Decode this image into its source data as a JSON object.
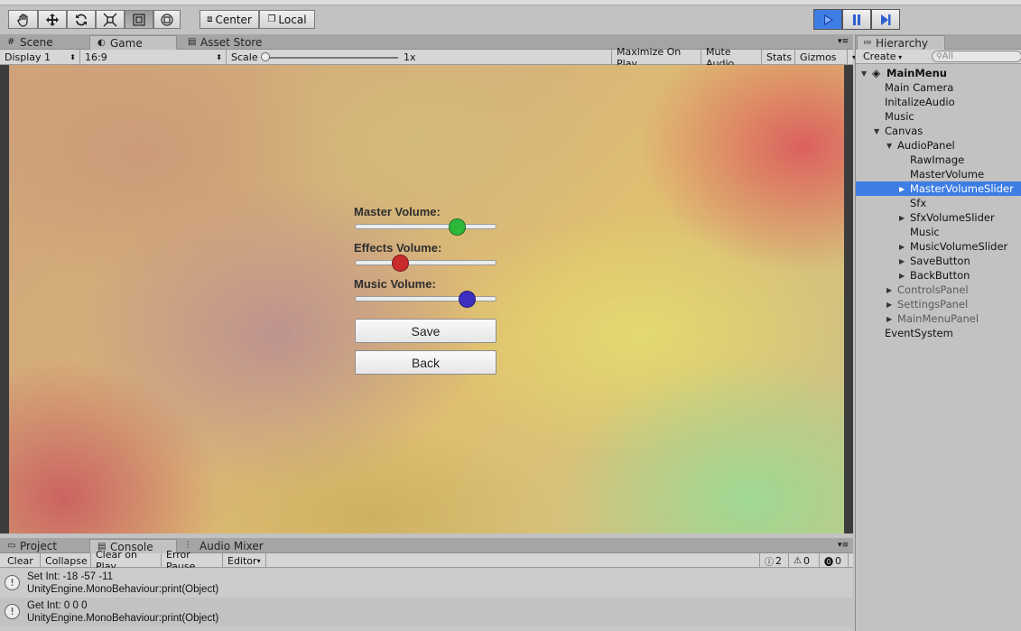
{
  "toolbar": {
    "pivot_label": "Center",
    "space_label": "Local",
    "tools": [
      "hand-tool",
      "move-tool",
      "rotate-tool",
      "scale-tool",
      "rect-tool",
      "transform-tool"
    ],
    "active_tool": "rect-tool",
    "play_state": "playing",
    "accent": "#3e7de3"
  },
  "main_tabs": [
    "Scene",
    "Game",
    "Asset Store"
  ],
  "active_main_tab": "Game",
  "game_bar": {
    "display": "Display 1",
    "aspect": "16:9",
    "scale_label": "Scale",
    "scale_value": "1x",
    "maximize": "Maximize On Play",
    "mute": "Mute Audio",
    "stats": "Stats",
    "gizmos": "Gizmos"
  },
  "game_ui": {
    "master_label": "Master Volume:",
    "effects_label": "Effects Volume:",
    "music_label": "Music Volume:",
    "master_value": 0.75,
    "effects_value": 0.3,
    "music_value": 0.83,
    "master_color": "#2db83a",
    "effects_color": "#c92b2b",
    "music_color": "#3d2fbf",
    "save_label": "Save",
    "back_label": "Back"
  },
  "hierarchy": {
    "tab": "Hierarchy",
    "create": "Create",
    "search_placeholder": "All",
    "scene": "MainMenu",
    "items": [
      {
        "label": "Main Camera"
      },
      {
        "label": "InitalizeAudio"
      },
      {
        "label": "Music"
      },
      {
        "label": "Canvas"
      },
      {
        "label": "AudioPanel"
      },
      {
        "label": "RawImage"
      },
      {
        "label": "MasterVolume"
      },
      {
        "label": "MasterVolumeSlider"
      },
      {
        "label": "Sfx"
      },
      {
        "label": "SfxVolumeSlider"
      },
      {
        "label": "Music"
      },
      {
        "label": "MusicVolumeSlider"
      },
      {
        "label": "SaveButton"
      },
      {
        "label": "BackButton"
      },
      {
        "label": "ControlsPanel"
      },
      {
        "label": "SettingsPanel"
      },
      {
        "label": "MainMenuPanel"
      },
      {
        "label": "EventSystem"
      }
    ],
    "selected": "MasterVolumeSlider"
  },
  "bottom_tabs": [
    "Project",
    "Console",
    "Audio Mixer"
  ],
  "active_bottom_tab": "Console",
  "console_bar": {
    "clear": "Clear",
    "collapse": "Collapse",
    "clear_on_play": "Clear on Play",
    "error_pause": "Error Pause",
    "editor": "Editor",
    "log_count": "2",
    "warn_count": "0",
    "error_count": "0"
  },
  "logs": [
    {
      "line1": "Set Int: -18 -57 -11",
      "line2": "UnityEngine.MonoBehaviour:print(Object)"
    },
    {
      "line1": "Get Int: 0 0 0",
      "line2": "UnityEngine.MonoBehaviour:print(Object)"
    }
  ]
}
